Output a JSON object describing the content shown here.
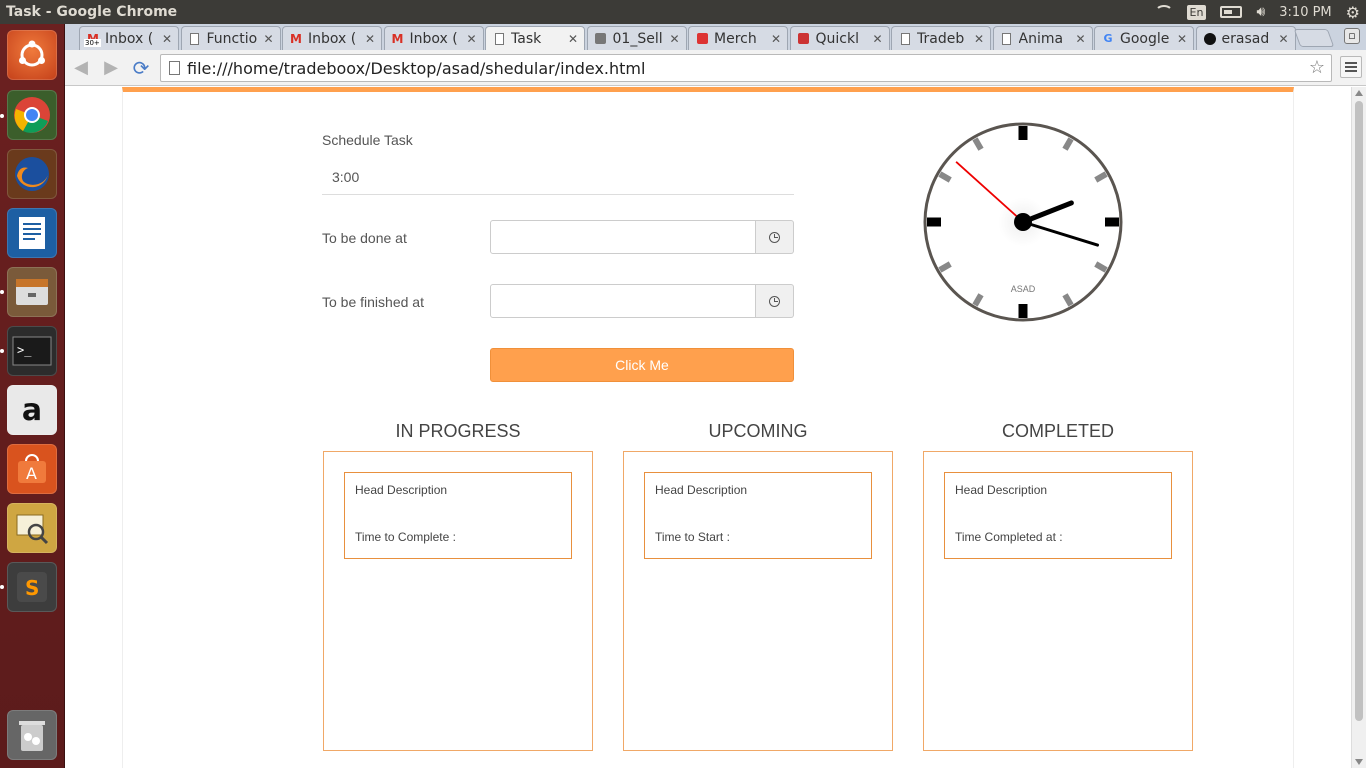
{
  "system": {
    "window_title": "Task - Google Chrome",
    "keyboard_layout": "En",
    "clock": "3:10 PM",
    "icons": [
      "wifi-icon",
      "battery-icon",
      "volume-icon",
      "gear-icon"
    ]
  },
  "launcher": {
    "items": [
      {
        "name": "ubuntu-dash-icon",
        "color": "#e95420"
      },
      {
        "name": "chrome-icon",
        "color": "#2f8a3b"
      },
      {
        "name": "firefox-icon",
        "color": "#e86a1c"
      },
      {
        "name": "writer-icon",
        "color": "#1d5fa3"
      },
      {
        "name": "files-icon",
        "color": "#c7752a"
      },
      {
        "name": "terminal-icon",
        "color": "#3a3a3a"
      },
      {
        "name": "amazon-icon",
        "color": "#e9e9e9"
      },
      {
        "name": "software-center-icon",
        "color": "#e86a1c"
      },
      {
        "name": "image-viewer-icon",
        "color": "#cfa642"
      },
      {
        "name": "sublime-icon",
        "color": "#3d3d3d"
      },
      {
        "name": "trash-icon",
        "color": "#7a7a7a"
      }
    ]
  },
  "browser": {
    "tabs": [
      {
        "label": "Inbox (",
        "icon": "gmail-icon"
      },
      {
        "label": "Functio",
        "icon": "page-icon"
      },
      {
        "label": "Inbox (",
        "icon": "gmail-icon"
      },
      {
        "label": "Inbox (",
        "icon": "gmail-icon"
      },
      {
        "label": "Task",
        "icon": "page-icon",
        "active": true
      },
      {
        "label": "01_Sell",
        "icon": "contact-icon"
      },
      {
        "label": "Merch",
        "icon": "merchant-icon"
      },
      {
        "label": "Quickl",
        "icon": "quick-icon"
      },
      {
        "label": "Tradeb",
        "icon": "page-icon"
      },
      {
        "label": "Anima",
        "icon": "page-icon"
      },
      {
        "label": "Google",
        "icon": "google-icon"
      },
      {
        "label": "erasad",
        "icon": "github-icon"
      }
    ],
    "gmail_badge": "30+",
    "url": "file:///home/tradeboox/Desktop/asad/shedular/index.html"
  },
  "form": {
    "schedule_label": "Schedule Task",
    "schedule_value": "3:00",
    "done_at_label": "To be done at",
    "done_at_value": "",
    "finished_at_label": "To be finished at",
    "finished_at_value": "",
    "submit_label": "Click Me",
    "accent": "#ffa04d"
  },
  "clock": {
    "brand": "ASAD",
    "time": {
      "hours": 2,
      "minutes": 17,
      "seconds": 52
    }
  },
  "columns": [
    {
      "title": "IN PROGRESS",
      "card": {
        "head": "Head Description",
        "time_label": "Time to Complete :"
      }
    },
    {
      "title": "UPCOMING",
      "card": {
        "head": "Head Description",
        "time_label": "Time to Start :"
      }
    },
    {
      "title": "COMPLETED",
      "card": {
        "head": "Head Description",
        "time_label": "Time Completed at :"
      }
    }
  ]
}
